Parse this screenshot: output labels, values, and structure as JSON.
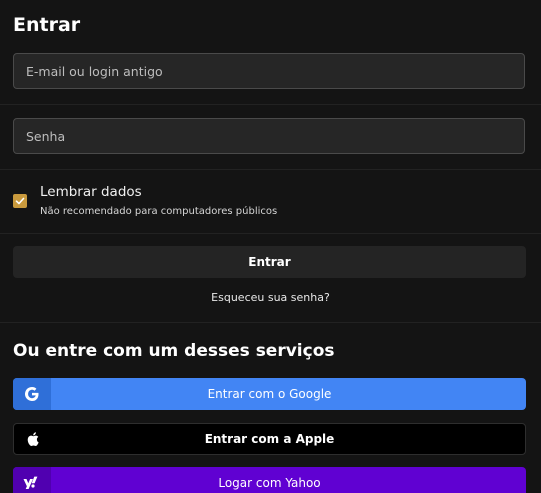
{
  "login": {
    "title": "Entrar",
    "email_placeholder": "E-mail ou login antigo",
    "password_placeholder": "Senha",
    "remember_label": "Lembrar dados",
    "remember_hint": "Não recomendado para computadores públicos",
    "remember_checked": true,
    "submit_label": "Entrar",
    "forgot_label": "Esqueceu sua senha?"
  },
  "social": {
    "title": "Ou entre com um desses serviços",
    "buttons": [
      {
        "label": "Entrar com o Google",
        "icon": "google-icon",
        "color": "#4285f4"
      },
      {
        "label": "Entrar com a Apple",
        "icon": "apple-icon",
        "color": "#000000"
      },
      {
        "label": "Logar com Yahoo",
        "icon": "yahoo-icon",
        "color": "#6001d2"
      }
    ]
  },
  "colors": {
    "background": "#141414",
    "accent_checkbox": "#c99a3d"
  }
}
